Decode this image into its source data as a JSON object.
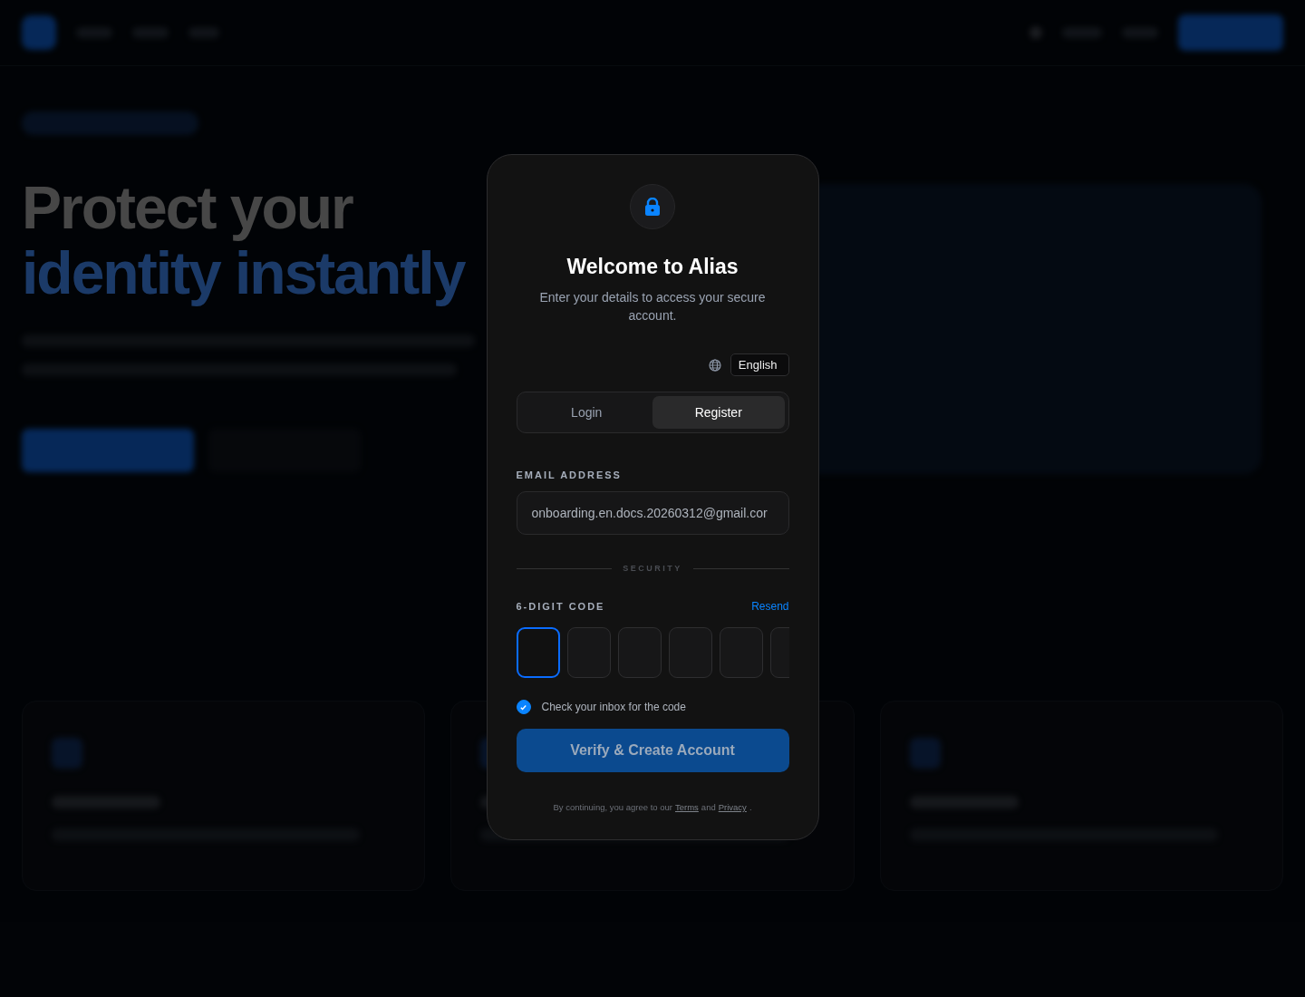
{
  "background_page": {
    "hero": {
      "title_line_1": "Protect your",
      "title_line_2": "identity instantly"
    }
  },
  "dialog": {
    "title": "Welcome to Alias",
    "subtitle": "Enter your details to access your secure account.",
    "language": "English",
    "tabs": [
      {
        "label": "Login",
        "selected": false
      },
      {
        "label": "Register",
        "selected": true
      }
    ],
    "email": {
      "label": "EMAIL ADDRESS",
      "value": "onboarding.en.docs.20260312@gmail.cor"
    },
    "divider": "SECURITY",
    "code": {
      "label": "6-DIGIT CODE",
      "resend": "Resend",
      "digits": [
        {
          "selected": true
        },
        {
          "selected": false
        },
        {
          "selected": false
        },
        {
          "selected": false
        },
        {
          "selected": false
        },
        {
          "selected": false
        }
      ]
    },
    "inbox_check": {
      "label": "Check your inbox for the code",
      "checked": true
    },
    "submit": "Verify & Create Account",
    "legal": {
      "prefix": "By continuing, you agree to our",
      "terms": "Terms",
      "and": "and",
      "privacy": "Privacy",
      "suffix": "."
    }
  }
}
